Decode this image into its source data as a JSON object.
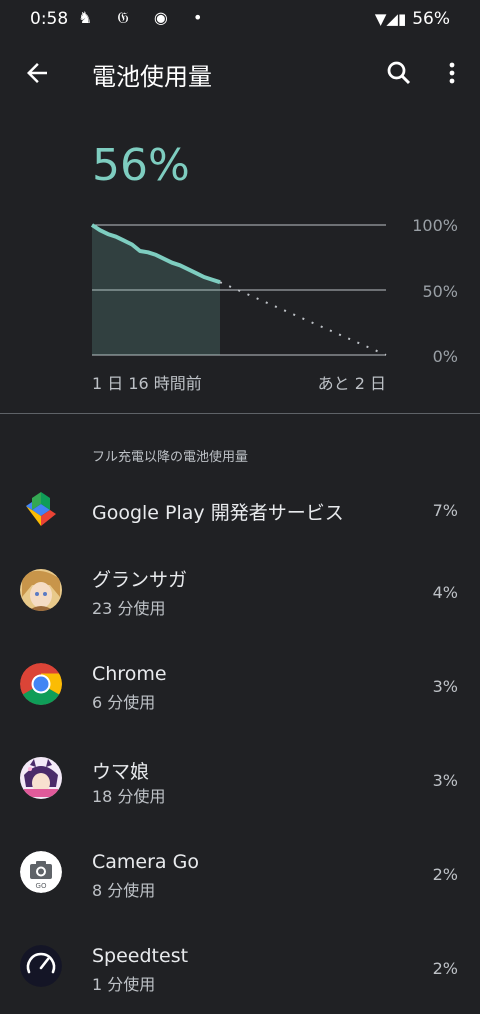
{
  "status": {
    "time": "0:58",
    "battery": "56%",
    "left_icons": "♞ 𝔊 ◉ •",
    "right_icons": "▼◢▮"
  },
  "appbar": {
    "title": "電池使用量"
  },
  "battery": {
    "percent": "56%",
    "axis_y": [
      "100%",
      "50%",
      "0%"
    ],
    "axis_x_start": "1 日 16 時間前",
    "axis_x_end": "あと 2 日",
    "line_color": "#7ecdc0"
  },
  "section_title": "フル充電以降の電池使用量",
  "apps": [
    {
      "name": "Google Play 開発者サービス",
      "usage": "",
      "percent": "7%",
      "icon": "google-play-services-icon"
    },
    {
      "name": "グランサガ",
      "usage": "23 分使用",
      "percent": "4%",
      "icon": "gran-saga-icon"
    },
    {
      "name": "Chrome",
      "usage": "6 分使用",
      "percent": "3%",
      "icon": "chrome-icon"
    },
    {
      "name": "ウマ娘",
      "usage": "18 分使用",
      "percent": "3%",
      "icon": "uma-musume-icon"
    },
    {
      "name": "Camera Go",
      "usage": "8 分使用",
      "percent": "2%",
      "icon": "camera-go-icon"
    },
    {
      "name": "Speedtest",
      "usage": "1 分使用",
      "percent": "2%",
      "icon": "speedtest-icon"
    }
  ],
  "chart_data": {
    "type": "line",
    "title": "",
    "ylim": [
      0,
      100
    ],
    "x_range": [
      "1 日 16 時間前",
      "あと 2 日"
    ],
    "series": [
      {
        "values": [
          100,
          96,
          93,
          91,
          88,
          85,
          80,
          79,
          77,
          74,
          71,
          69,
          66,
          63,
          60,
          58,
          56
        ]
      },
      {
        "values": [
          56,
          49,
          42,
          35,
          28,
          21,
          14,
          7,
          0
        ]
      }
    ]
  }
}
